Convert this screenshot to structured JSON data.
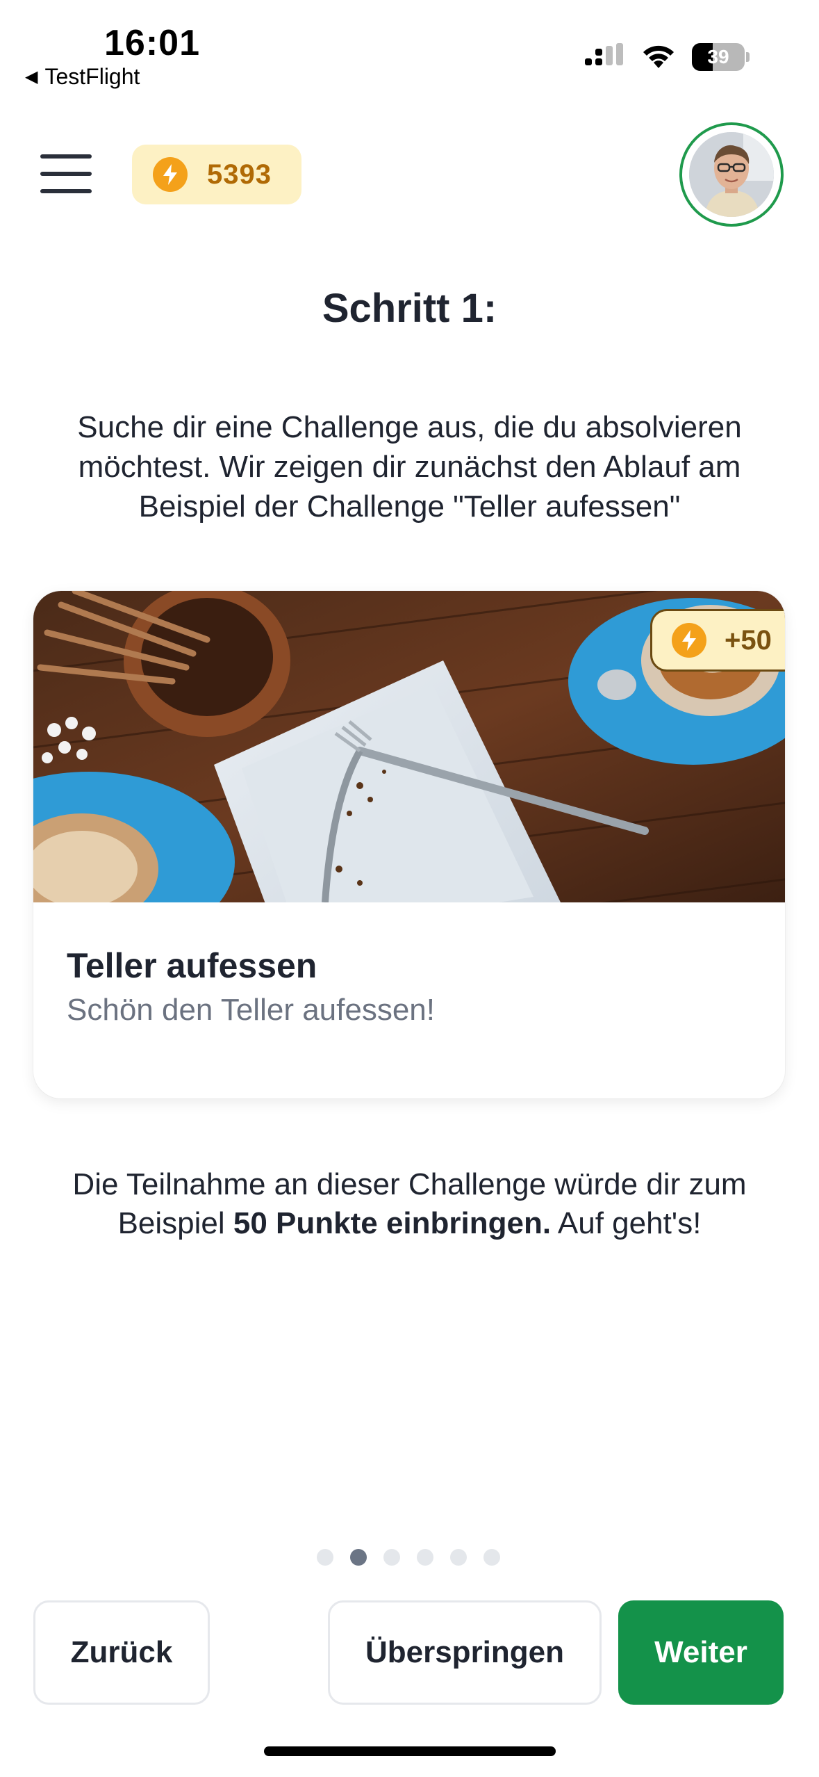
{
  "status_bar": {
    "time": "16:01",
    "back_app": "TestFlight",
    "battery": "39"
  },
  "header": {
    "points": "5393",
    "points_icon": "lightning-bolt-icon"
  },
  "step": {
    "title": "Schritt 1:",
    "intro": "Suche dir eine Challenge aus, die du absolvieren möchtest. Wir zeigen dir zunächst den Ablauf am Beispiel der Challenge \"Teller aufessen\""
  },
  "challenge_card": {
    "reward": "+50",
    "title": "Teller aufessen",
    "subtitle": "Schön den Teller aufessen!"
  },
  "outro": {
    "prefix": "Die Teilnahme an dieser Challenge würde dir zum Beispiel ",
    "highlight": "50 Punkte einbringen.",
    "suffix": " Auf geht's!"
  },
  "pagination": {
    "total": 6,
    "active_index": 1
  },
  "buttons": {
    "back": "Zurück",
    "skip": "Überspringen",
    "next": "Weiter"
  },
  "colors": {
    "primary_green": "#14924a",
    "points_bg": "#fdf1c4",
    "points_text": "#b06a05",
    "bolt": "#f4a11a"
  }
}
